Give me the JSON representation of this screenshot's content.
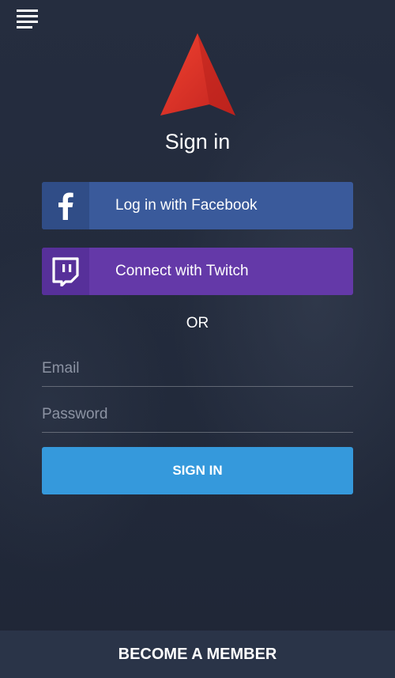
{
  "header": {
    "menu_icon": "hamburger-menu-icon",
    "logo_icon": "red-triangle-logo"
  },
  "title": "Sign in",
  "social": {
    "facebook": {
      "label": "Log in with Facebook",
      "icon": "facebook-icon",
      "color": "#3a5a9b"
    },
    "twitch": {
      "label": "Connect with Twitch",
      "icon": "twitch-icon",
      "color": "#6439a8"
    }
  },
  "divider_text": "OR",
  "form": {
    "email": {
      "placeholder": "Email",
      "value": ""
    },
    "password": {
      "placeholder": "Password",
      "value": ""
    },
    "submit_label": "SIGN IN",
    "submit_color": "#3599dc"
  },
  "footer": {
    "label": "BECOME A MEMBER"
  },
  "colors": {
    "background": "#222a3b",
    "accent_red": "#e0332a"
  }
}
